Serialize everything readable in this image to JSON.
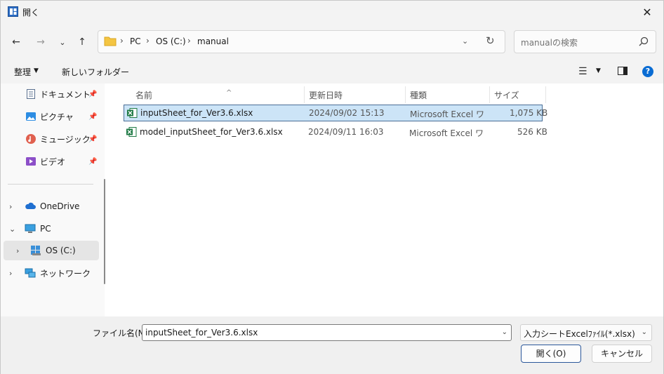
{
  "window": {
    "title": "開く"
  },
  "nav": {
    "breadcrumbs": [
      "PC",
      "OS (C:)",
      "manual"
    ],
    "search_placeholder": "manualの検索"
  },
  "toolbar": {
    "organize_label": "整理",
    "new_folder_label": "新しいフォルダー"
  },
  "sidebar": {
    "quick_access": [
      {
        "label": "ドキュメント",
        "icon": "document-icon",
        "pinned": true
      },
      {
        "label": "ピクチャ",
        "icon": "pictures-icon",
        "pinned": true
      },
      {
        "label": "ミュージック",
        "icon": "music-icon",
        "pinned": true
      },
      {
        "label": "ビデオ",
        "icon": "video-icon",
        "pinned": true
      }
    ],
    "tree": [
      {
        "label": "OneDrive",
        "icon": "cloud-icon",
        "expanded": false
      },
      {
        "label": "PC",
        "icon": "pc-icon",
        "expanded": true
      },
      {
        "label": "OS (C:)",
        "icon": "drive-icon",
        "expanded": false,
        "selected": true
      },
      {
        "label": "ネットワーク",
        "icon": "network-icon",
        "expanded": false
      }
    ]
  },
  "filelist": {
    "columns": [
      "名前",
      "更新日時",
      "種類",
      "サイズ"
    ],
    "rows": [
      {
        "name": "inputSheet_for_Ver3.6.xlsx",
        "modified": "2024/09/02 15:13",
        "type": "Microsoft Excel ワ...",
        "size": "1,075 KB",
        "selected": true
      },
      {
        "name": "model_inputSheet_for_Ver3.6.xlsx",
        "modified": "2024/09/11 16:03",
        "type": "Microsoft Excel ワ...",
        "size": "526 KB",
        "selected": false
      }
    ]
  },
  "bottom": {
    "filename_label": "ファイル名(N):",
    "filename_value": "inputSheet_for_Ver3.6.xlsx",
    "filter_value": "入力シートExcelﾌｧｲﾙ(*.xlsx)",
    "open_label": "開く(O)",
    "cancel_label": "キャンセル"
  },
  "colors": {
    "accent": "#0a6cd3",
    "selection": "#cce4f7",
    "excel_green": "#1f7a45",
    "folder_yellow": "#f4c542"
  }
}
